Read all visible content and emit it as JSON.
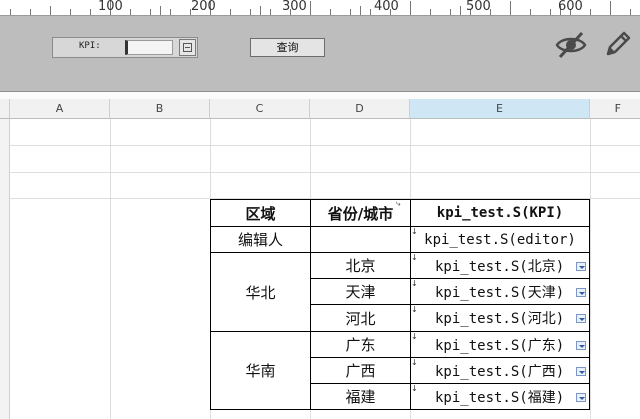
{
  "ruler": {
    "ticks": [
      "100",
      "200",
      "300",
      "400",
      "500",
      "600"
    ]
  },
  "panel": {
    "kpi_label": "KPI:",
    "kpi_value": "",
    "query_label": "查询",
    "icons": [
      "eye-slash-icon",
      "pencil-icon"
    ]
  },
  "columns": [
    "A",
    "B",
    "C",
    "D",
    "E",
    "F"
  ],
  "table": {
    "headers": {
      "region": "区域",
      "province": "省份/城市",
      "kpi": "kpi_test.S(KPI)"
    },
    "editor": {
      "label": "编辑人",
      "value": "kpi_test.S(editor)"
    },
    "groups": [
      {
        "region": "华北",
        "rows": [
          {
            "city": "北京",
            "value": "kpi_test.S(北京)"
          },
          {
            "city": "天津",
            "value": "kpi_test.S(天津)"
          },
          {
            "city": "河北",
            "value": "kpi_test.S(河北)"
          }
        ]
      },
      {
        "region": "华南",
        "rows": [
          {
            "city": "广东",
            "value": "kpi_test.S(广东)"
          },
          {
            "city": "广西",
            "value": "kpi_test.S(广西)"
          },
          {
            "city": "福建",
            "value": "kpi_test.S(福建)"
          }
        ]
      }
    ]
  },
  "colors": {
    "panel_bg": "#bdbdbd",
    "active_col": "#cfe6f5"
  }
}
